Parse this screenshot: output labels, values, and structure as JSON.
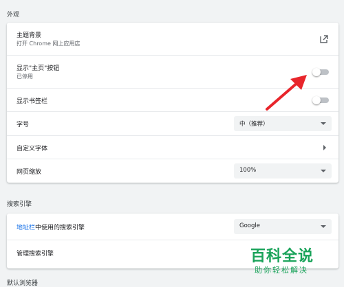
{
  "appearance": {
    "title": "外观",
    "theme": {
      "label": "主题背景",
      "sub": "打开 Chrome 网上应用店"
    },
    "home_button": {
      "label": "显示\"主页\"按钮",
      "sub": "已停用",
      "enabled": false
    },
    "bookmarks_bar": {
      "label": "显示书签栏",
      "enabled": false
    },
    "font_size": {
      "label": "字号",
      "value": "中（推荐）"
    },
    "custom_fonts": {
      "label": "自定义字体"
    },
    "page_zoom": {
      "label": "网页缩放",
      "value": "100%"
    }
  },
  "search_engine": {
    "title": "搜索引擎",
    "address_bar": {
      "label_link": "地址栏",
      "label_rest": "中使用的搜索引擎",
      "value": "Google"
    },
    "manage": {
      "label": "管理搜索引擎"
    }
  },
  "default_browser": {
    "title": "默认浏览器"
  },
  "watermark": {
    "logo": "百科全说",
    "sub": "助你轻松解决"
  },
  "colors": {
    "accent": "#1a73e8",
    "annotation_arrow": "#e8252b",
    "watermark": "#1aa35a"
  }
}
